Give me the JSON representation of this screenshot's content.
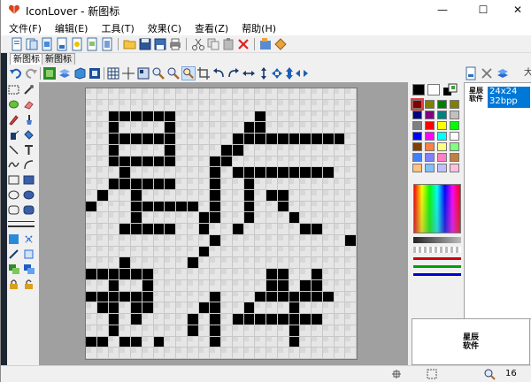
{
  "window": {
    "title": "IconLover - 新图标",
    "controls": {
      "minimize": "—",
      "maximize": "☐",
      "close": "✕"
    }
  },
  "menu": [
    {
      "label": "文件(F)"
    },
    {
      "label": "编辑(E)"
    },
    {
      "label": "工具(T)"
    },
    {
      "label": "效果(C)"
    },
    {
      "label": "查看(Z)"
    },
    {
      "label": "帮助(H)"
    }
  ],
  "tabs": [
    {
      "label": "新图标"
    },
    {
      "label": "新图标"
    }
  ],
  "formats": [
    {
      "size": "24x24",
      "depth": "32bpp"
    }
  ],
  "preview": {
    "line1": "星辰",
    "line2": "软件"
  },
  "right_clip": "大",
  "status": {
    "zoom": "16"
  },
  "colors": {
    "accent": "#0078d7",
    "palette": [
      "#000000",
      "#ffffff",
      "#800000",
      "#808000",
      "#008000",
      "#808000",
      "#000080",
      "#800080",
      "#008080",
      "#c0c0c0",
      "#808080",
      "#ff0000",
      "#ffff00",
      "#00ff00",
      "#0000ff",
      "#ff00ff",
      "#00ffff",
      "#ffffff",
      "#804000",
      "#ff8040",
      "#ffff80",
      "#80ff80",
      "#4080ff",
      "#8080ff",
      "#ff80c0",
      "#c08040",
      "#ffc080",
      "#80c0ff",
      "#c0c0ff",
      "#ffc0e0"
    ]
  },
  "icons": [
    "app-heart-icon",
    "new-file-icon",
    "open-icon",
    "save-icon",
    "print-icon",
    "cut-icon",
    "copy-icon",
    "paste-icon",
    "delete-icon",
    "undo-icon",
    "redo-icon",
    "pencil-icon",
    "brush-icon",
    "fill-icon",
    "eyedropper-icon",
    "text-icon",
    "line-icon",
    "curve-icon",
    "rectangle-icon",
    "ellipse-icon",
    "rounded-rect-icon",
    "select-icon",
    "zoom-icon",
    "grid-icon"
  ]
}
